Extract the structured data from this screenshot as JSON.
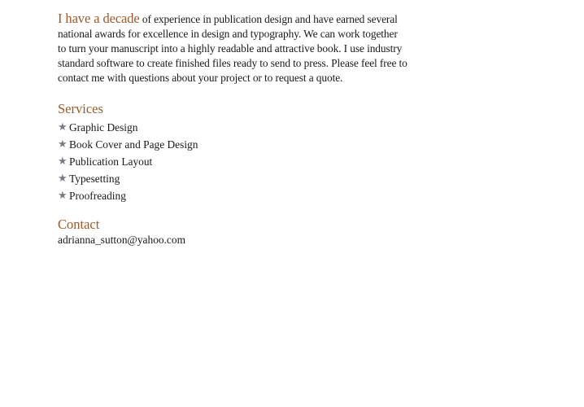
{
  "intro": {
    "lead": "I have a decade",
    "text": " of experience in publication design and have earned several national awards for excellence in design and typography. We can work together to turn your manuscript into a highly readable and attractive book. I use industry standard software to create finished files ready to send to press. Please feel free to contact me with questions about your project or to request a quote."
  },
  "services": {
    "heading": "Services",
    "bullet_icon": "star-icon",
    "bullet_color": "#7a7a82",
    "items": [
      {
        "label": "Graphic Design"
      },
      {
        "label": "Book Cover and Page Design"
      },
      {
        "label": "Publication Layout"
      },
      {
        "label": "Typesetting"
      },
      {
        "label": "Proofreading"
      }
    ]
  },
  "contact": {
    "heading": "Contact",
    "email": "adrianna_sutton@yahoo.com"
  },
  "colors": {
    "accent": "#9a5a2c",
    "text": "#1a1a1a"
  }
}
